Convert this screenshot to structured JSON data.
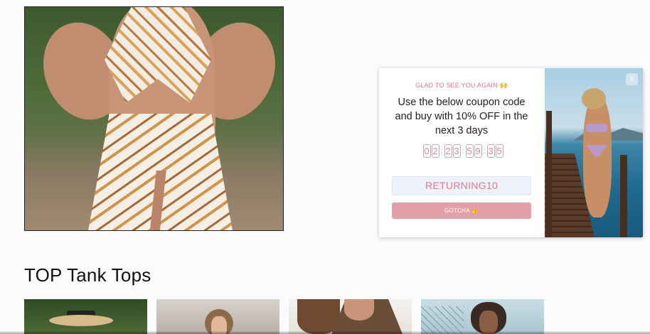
{
  "section": {
    "title": "TOP Tank Tops"
  },
  "popup": {
    "greeting": "GLAD TO SEE YOU AGAIN 🙌",
    "message": "Use the below coupon code and buy with 10% OFF in the next 3 days",
    "countdown": {
      "digits": [
        "0",
        "2",
        "2",
        "3",
        "5",
        "9",
        "3",
        "5"
      ],
      "separator": ":"
    },
    "coupon_code": "RETURNING10",
    "button_label": "GOTCHA 👍",
    "close_label": "X"
  },
  "colors": {
    "accent_pink": "#e07a8c",
    "button_pink": "#e2a0a8",
    "coupon_bg": "#eef2fb"
  }
}
